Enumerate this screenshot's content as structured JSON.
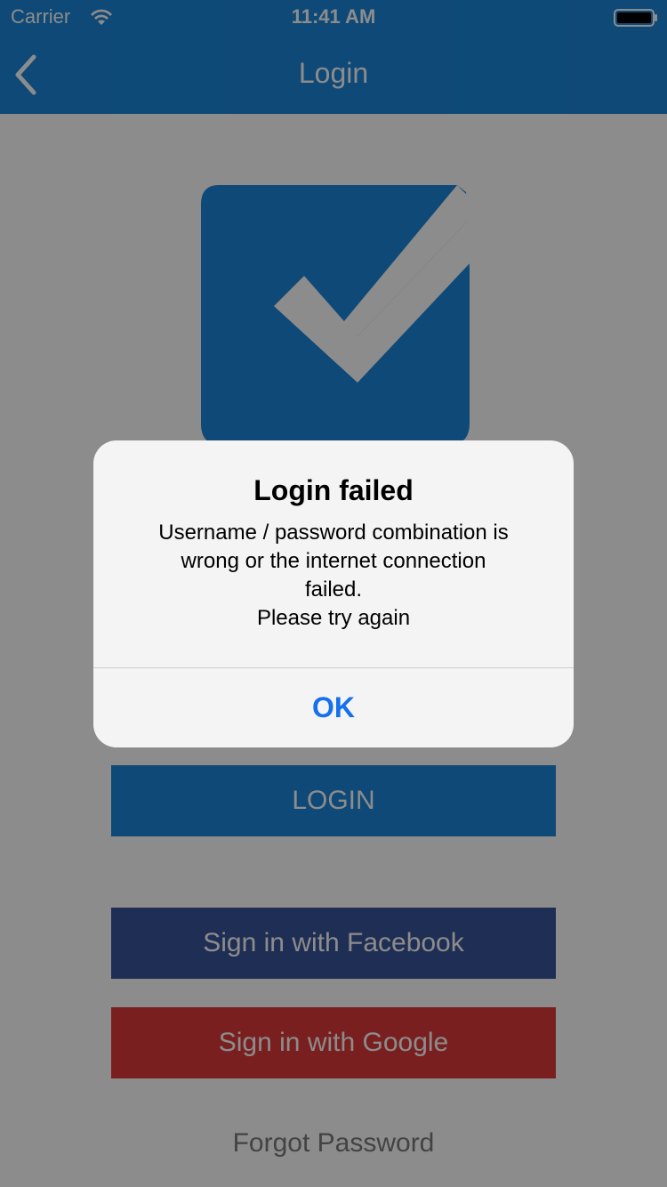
{
  "status_bar": {
    "carrier": "Carrier",
    "time": "11:41 AM",
    "wifi_icon": "wifi-icon",
    "battery_icon": "battery-icon"
  },
  "nav": {
    "back_icon": "chevron-left-icon",
    "title": "Login"
  },
  "logo": {
    "icon": "checkbox-checked-icon",
    "color": "#1a86d9"
  },
  "buttons": {
    "login": "LOGIN",
    "facebook": "Sign in with Facebook",
    "google": "Sign in with Google",
    "forgot_password": "Forgot Password"
  },
  "alert": {
    "title": "Login failed",
    "message_lines": [
      "Username / password combination is",
      "wrong or the internet connection",
      "failed.",
      "Please try again"
    ],
    "ok_label": "OK"
  },
  "colors": {
    "primary": "#1a86d9",
    "facebook": "#3a5599",
    "google": "#de3a3a",
    "alert_action": "#1470ee"
  }
}
